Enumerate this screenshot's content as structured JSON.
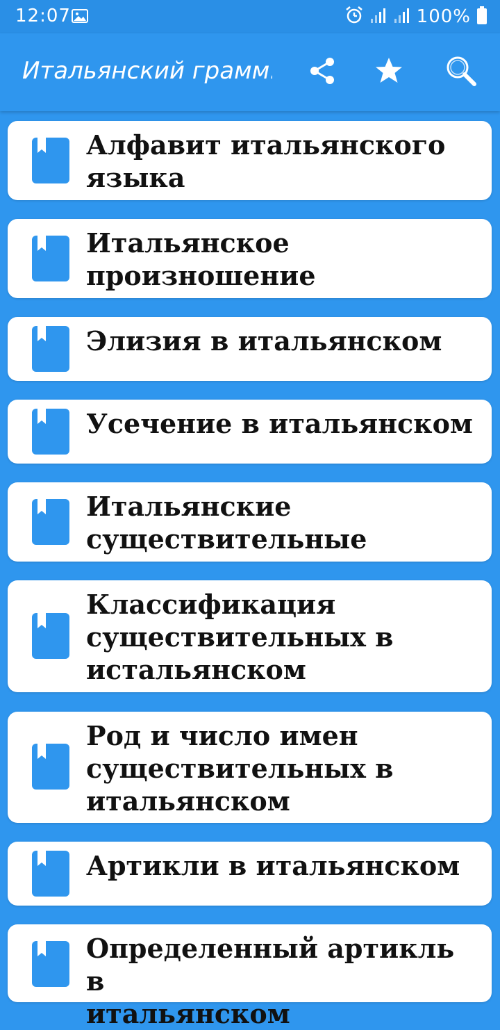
{
  "status_bar": {
    "time": "12:07",
    "battery_percent": "100%",
    "icons": [
      "gallery-icon",
      "alarm-icon",
      "signal-icon",
      "signal-icon",
      "battery-icon"
    ]
  },
  "app_bar": {
    "title": "Итальянский грамм...",
    "actions": [
      "share-icon",
      "star-icon",
      "search-icon"
    ]
  },
  "colors": {
    "primary": "#2f96ee",
    "card_background": "#ffffff",
    "text": "#111111"
  },
  "items": [
    {
      "label": "Алфавит итальянского\nязыка",
      "icon": "bookmark-icon"
    },
    {
      "label": "Итальянское\nпроизношение",
      "icon": "bookmark-icon"
    },
    {
      "label": "Элизия в итальянском",
      "icon": "bookmark-icon"
    },
    {
      "label": "Усечение в итальянском",
      "icon": "bookmark-icon"
    },
    {
      "label": "Итальянские\nсуществительные",
      "icon": "bookmark-icon"
    },
    {
      "label": "Классификация\nсуществительных в\nистальянском",
      "icon": "bookmark-icon"
    },
    {
      "label": "Род и число имен\nсуществительных в\nитальянском",
      "icon": "bookmark-icon"
    },
    {
      "label": "Артикли в итальянском",
      "icon": "bookmark-icon"
    },
    {
      "label": "Определенный артикль в\nитальянском",
      "icon": "bookmark-icon"
    }
  ]
}
